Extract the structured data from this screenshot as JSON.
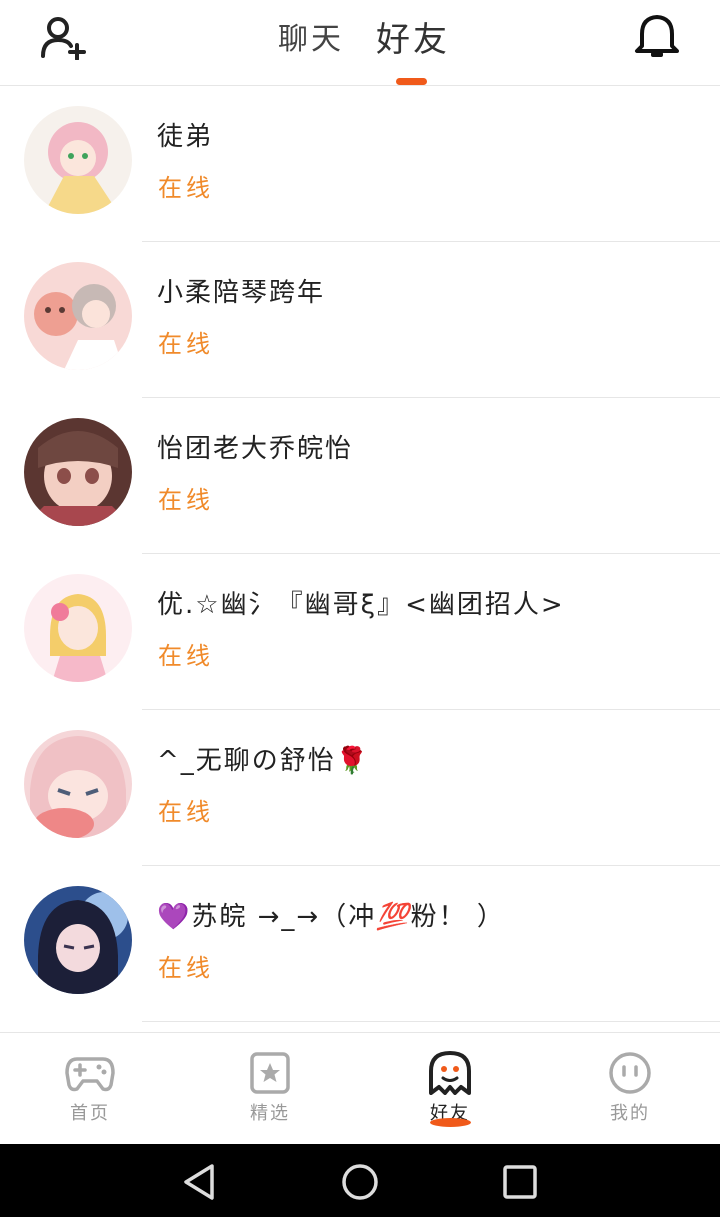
{
  "header": {
    "tabs": [
      {
        "label": "聊天"
      },
      {
        "label": "好友"
      }
    ]
  },
  "friends": [
    {
      "name": "徒弟",
      "status": "在线",
      "avatar_colors": [
        "#f4c7cf",
        "#f7e1a9",
        "#e08aa1"
      ]
    },
    {
      "name": "小柔陪琴跨年",
      "status": "在线",
      "avatar_colors": [
        "#f6c9c5",
        "#e8a79b",
        "#bfa9a3"
      ]
    },
    {
      "name": "怡团老大乔皖怡",
      "status": "在线",
      "avatar_colors": [
        "#6b4039",
        "#e7b6a8",
        "#9c5a51"
      ]
    },
    {
      "name_parts": {
        "a": "优.☆幽氵『幽哥ξ』<幽团招人>"
      },
      "status": "在线",
      "avatar_colors": [
        "#fbe2e8",
        "#f3c45d",
        "#f09ab2"
      ]
    },
    {
      "name_parts": {
        "a": "^_无聊の舒怡",
        "emoji": "🌹"
      },
      "status": "在线",
      "avatar_colors": [
        "#f3c3c7",
        "#ee7f7f",
        "#6f6b82"
      ]
    },
    {
      "name_parts": {
        "emoji1": "💜",
        "a": "苏皖 →_→（冲",
        "emoji2": "💯",
        "b": "粉！ ）"
      },
      "status": "在线",
      "avatar_colors": [
        "#1f3f78",
        "#8fb1de",
        "#24223d"
      ]
    }
  ],
  "bottom_nav": [
    {
      "label": "首页",
      "icon": "gamepad-icon"
    },
    {
      "label": "精选",
      "icon": "star-icon"
    },
    {
      "label": "好友",
      "icon": "ghost-icon",
      "active": true
    },
    {
      "label": "我的",
      "icon": "face-icon"
    }
  ],
  "colors": {
    "accent": "#f05a1a",
    "status_online": "#f08a2a"
  }
}
